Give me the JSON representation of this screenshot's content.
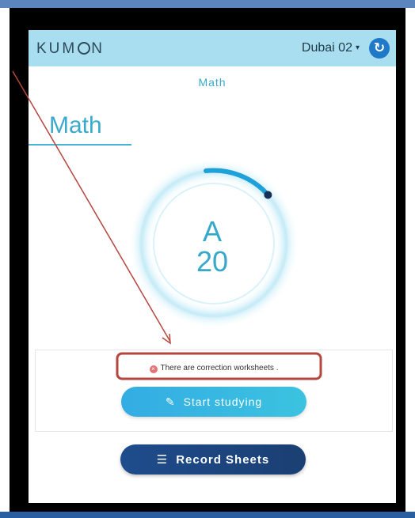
{
  "header": {
    "logo_text_1": "KUM",
    "logo_text_2": "N",
    "branch": "Dubai 02",
    "branch_caret": "▾",
    "refresh_icon": "↻"
  },
  "subject": {
    "tab_label": "Math",
    "title": "Math"
  },
  "progress": {
    "level": "A",
    "worksheet": "20",
    "fraction": 0.1
  },
  "notice": {
    "icon": "×",
    "text": "There are correction worksheets ."
  },
  "buttons": {
    "start_icon": "✎",
    "start_label": "Start studying",
    "record_icon": "☰",
    "record_label": "Record Sheets"
  },
  "colors": {
    "appbar": "#a9def0",
    "accent": "#35a8cb",
    "start_button": "#33ace3",
    "record_button": "#1f4c8c",
    "annotation": "#b5463f"
  }
}
